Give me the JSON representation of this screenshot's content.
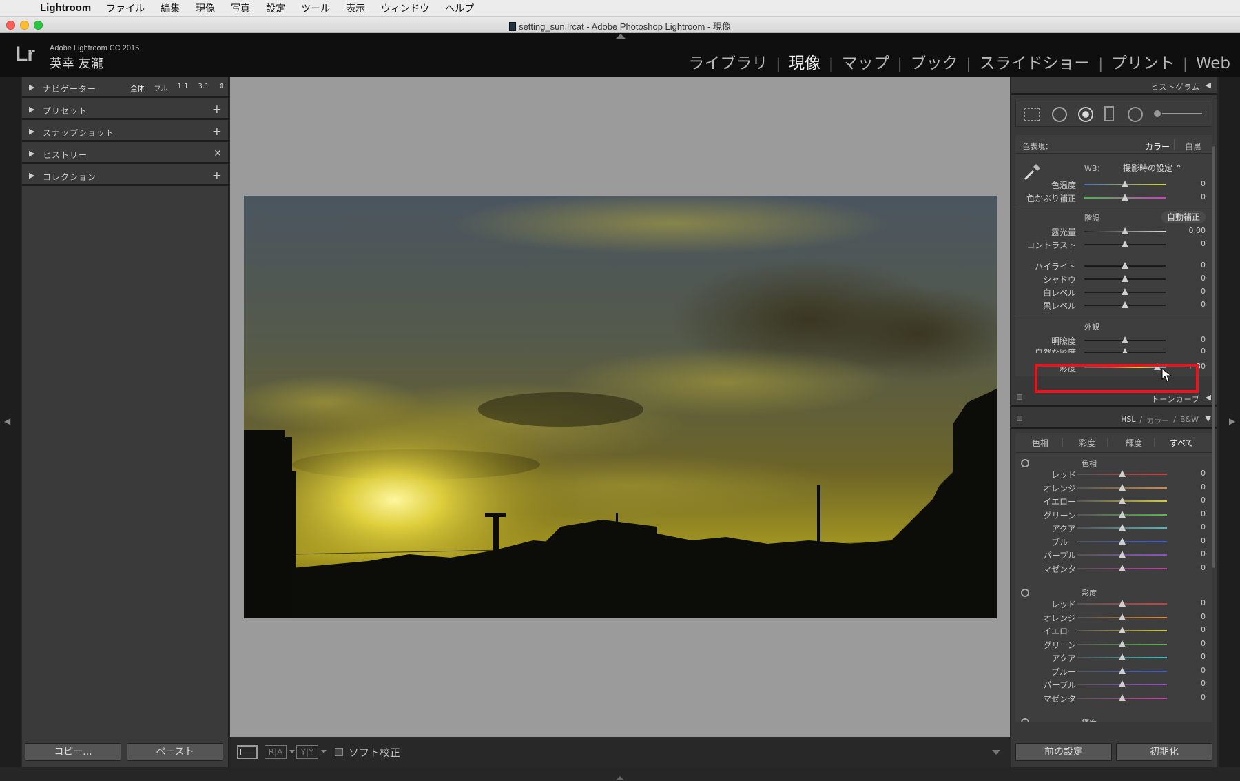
{
  "menubar": {
    "app_name": "Lightroom",
    "items": [
      "ファイル",
      "編集",
      "現像",
      "写真",
      "設定",
      "ツール",
      "表示",
      "ウィンドウ",
      "ヘルプ"
    ]
  },
  "window": {
    "title": "setting_sun.lrcat - Adobe Photoshop Lightroom - 現像"
  },
  "identity": {
    "logo": "Lr",
    "version": "Adobe Lightroom CC 2015",
    "user": "英幸 友瀧"
  },
  "modules": [
    "ライブラリ",
    "現像",
    "マップ",
    "ブック",
    "スライドショー",
    "プリント",
    "Web"
  ],
  "modules_active": "現像",
  "left_panel": {
    "navigator": {
      "label": "ナビゲーター",
      "options": [
        "全体",
        "フル",
        "1:1",
        "3:1"
      ]
    },
    "presets": "プリセット",
    "snapshots": "スナップショット",
    "history": "ヒストリー",
    "collections": "コレクション",
    "copy_button": "コピー...",
    "paste_button": "ペースト"
  },
  "toolbar": {
    "soft_proof": "ソフト校正",
    "compare_ra": "R|A",
    "compare_yy": "Y|Y"
  },
  "right_panel": {
    "histogram": "ヒストグラム",
    "basic": {
      "treatment_label": "色表現：",
      "treatment_color": "カラー",
      "treatment_bw": "白黒",
      "wb_label": "WB：",
      "wb_value": "撮影時の設定 ⌃",
      "temp": {
        "name": "色温度",
        "value": "0",
        "pos": 0.5
      },
      "tint": {
        "name": "色かぶり補正",
        "value": "0",
        "pos": 0.5
      },
      "tone_label": "階調",
      "auto": "自動補正",
      "exposure": {
        "name": "露光量",
        "value": "0.00",
        "pos": 0.5
      },
      "contrast": {
        "name": "コントラスト",
        "value": "0",
        "pos": 0.5
      },
      "highlights": {
        "name": "ハイライト",
        "value": "0",
        "pos": 0.5
      },
      "shadows": {
        "name": "シャドウ",
        "value": "0",
        "pos": 0.5
      },
      "whites": {
        "name": "白レベル",
        "value": "0",
        "pos": 0.5
      },
      "blacks": {
        "name": "黒レベル",
        "value": "0",
        "pos": 0.5
      },
      "presence_label": "外観",
      "clarity": {
        "name": "明瞭度",
        "value": "0",
        "pos": 0.5
      },
      "vibrance": {
        "name": "自然な彩度",
        "value": "0",
        "pos": 0.5
      },
      "saturation": {
        "name": "彩度",
        "value": "+ 80",
        "pos": 0.9
      }
    },
    "tone_curve": "トーンカーブ",
    "hsl_header": {
      "hsl": "HSL",
      "color": "カラー",
      "bw": "B&W"
    },
    "hsl_tabs": [
      "色相",
      "彩度",
      "輝度",
      "すべて"
    ],
    "hue_label": "色相",
    "sat_label": "彩度",
    "lum_label": "輝度",
    "colors": [
      "レッド",
      "オレンジ",
      "イエロー",
      "グリーン",
      "アクア",
      "ブルー",
      "パープル",
      "マゼンタ"
    ],
    "color_hex": [
      "#d04040",
      "#e08a30",
      "#d8c840",
      "#5cb850",
      "#40c0c0",
      "#4060d0",
      "#9050c8",
      "#c840a8"
    ],
    "hsl_value": "0",
    "prev_button": "前の設定",
    "reset_button": "初期化"
  },
  "highlight_color": "#e8141e"
}
